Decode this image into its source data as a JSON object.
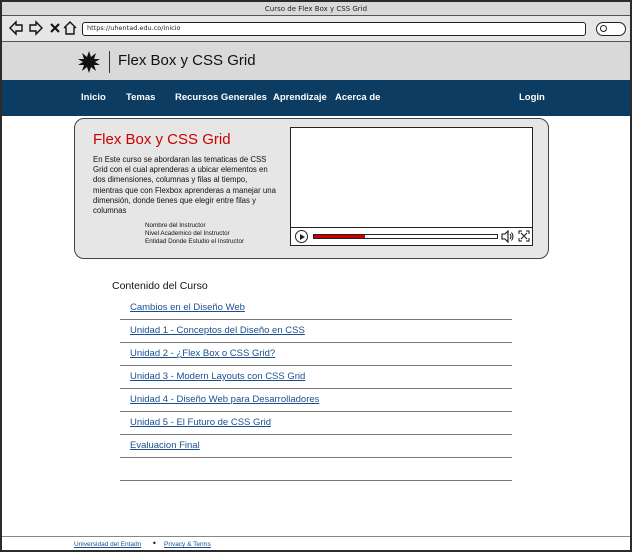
{
  "window": {
    "title": "Curso de Flex Box y CSS Grid"
  },
  "toolbar": {
    "url": "https://uhentad.edu.co/inicio",
    "icons": [
      "back-arrow-icon",
      "forward-arrow-icon",
      "close-icon",
      "home-icon",
      "search-icon"
    ]
  },
  "header": {
    "site_title": "Flex Box y CSS Grid",
    "logo_icon": "starburst-logo-icon"
  },
  "nav": {
    "items": [
      "Inicio",
      "Temas",
      "Recursos Generales",
      "Aprendizaje",
      "Acerca de"
    ],
    "login": "Login"
  },
  "hero": {
    "title": "Flex Box y CSS Grid",
    "description": "En Este curso se abordaran las tematicas de CSS Grid con el cual aprenderas a ubicar elementos en dos dimensiones, columnas y filas al tiempo, mientras que con Flexbox aprenderas a manejar una dimensión, donde tienes que elegir entre filas y columnas",
    "instructor_name": "Nombre del Instructor",
    "instructor_level": "Nivel Academico del Instructor",
    "instructor_entity": "Entidad Donde Estudio el Instructor",
    "video": {
      "progress": 0.28,
      "accent": "#cc0000"
    }
  },
  "content": {
    "title": "Contenido del Curso",
    "items": [
      "Cambios en el Diseño Web",
      "Unidad 1 - Conceptos del Diseño en CSS",
      "Unidad 2 - ¿Flex Box o CSS Grid?",
      "Unidad 3 - Modern Layouts con CSS Grid",
      "Unidad 4 - Diseño Web para Desarrolladores",
      "Unidad 5 - El Futuro de CSS Grid",
      "Evaluacion Final"
    ]
  },
  "footer": {
    "link1": "Universidad del Entadn",
    "link2": "Privacy & Terms"
  },
  "colors": {
    "nav_bg": "#0d3c62",
    "title_red": "#cc0000",
    "link_blue": "#1a4f8f"
  }
}
